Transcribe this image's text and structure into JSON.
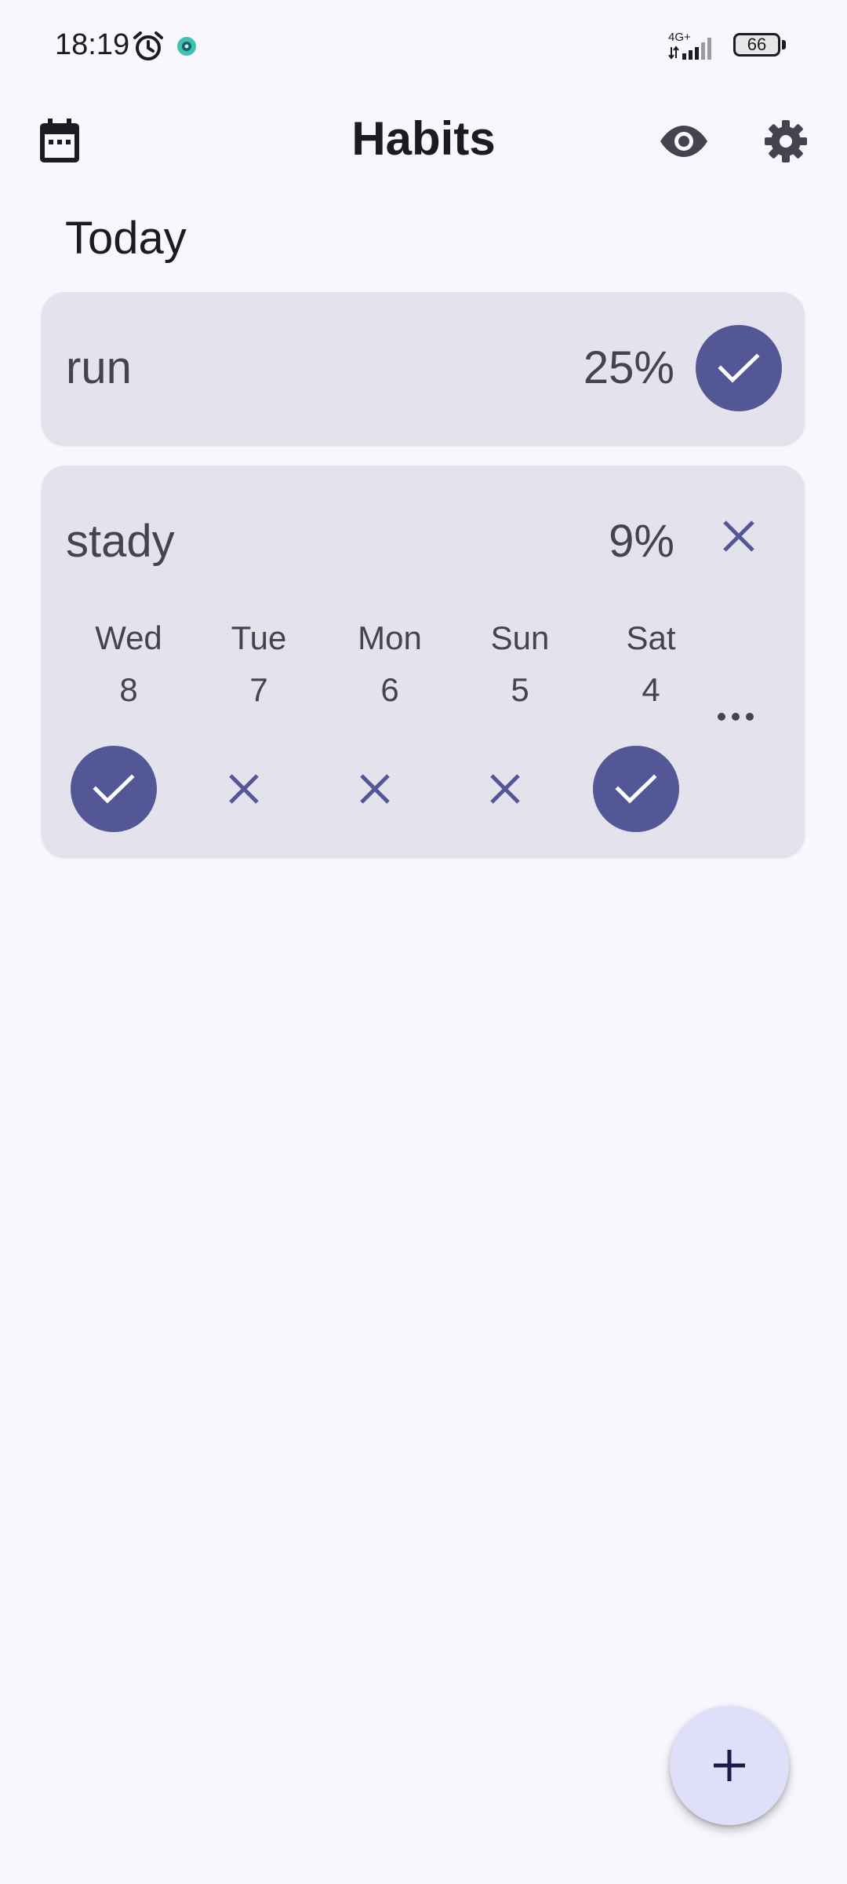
{
  "status_bar": {
    "time": "18:19",
    "network": "4G+",
    "battery": "66",
    "icons": [
      "alarm-icon",
      "camera-dot-icon",
      "signal-icon",
      "battery-icon"
    ]
  },
  "app_bar": {
    "title": "Habits",
    "icons": [
      "calendar-icon",
      "eye-icon",
      "gear-icon"
    ]
  },
  "section": {
    "title": "Today"
  },
  "habits": [
    {
      "name": "run",
      "percent": "25%",
      "today_status": "done"
    },
    {
      "name": "stady",
      "percent": "9%",
      "today_status": "not-done",
      "history": [
        {
          "day": "Wed",
          "date": "8",
          "status": "done"
        },
        {
          "day": "Tue",
          "date": "7",
          "status": "not-done"
        },
        {
          "day": "Mon",
          "date": "6",
          "status": "not-done"
        },
        {
          "day": "Sun",
          "date": "5",
          "status": "not-done"
        },
        {
          "day": "Sat",
          "date": "4",
          "status": "done"
        }
      ]
    }
  ],
  "colors": {
    "background": "#f8f7fd",
    "card": "#e4e2ec",
    "accent": "#545796",
    "fab": "#dfdffa",
    "text": "#44434f"
  },
  "fab": {
    "icon": "plus-icon"
  }
}
